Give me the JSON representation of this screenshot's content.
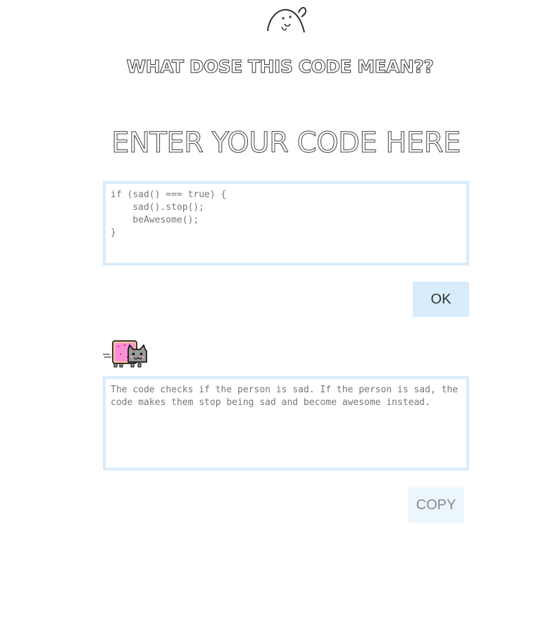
{
  "header": {
    "site_title": "WHAT DOSE THIS CODE MEAN??",
    "mascot_icon": "doodle-face-icon"
  },
  "input_section": {
    "heading": "ENTER YOUR CODE HERE",
    "code_value": "if (sad() === true) {\n    sad().stop();\n    beAwesome();\n}",
    "ok_label": "OK"
  },
  "output_section": {
    "cat_icon": "nyan-cat-icon",
    "result_text": "The code checks if the person is sad. If the person is sad, the code makes them stop being sad and become awesome instead.",
    "copy_label": "COPY"
  },
  "colors": {
    "box_border": "#d9ecfb",
    "ok_bg": "#d8edfb",
    "copy_bg": "#ecf6fd"
  }
}
